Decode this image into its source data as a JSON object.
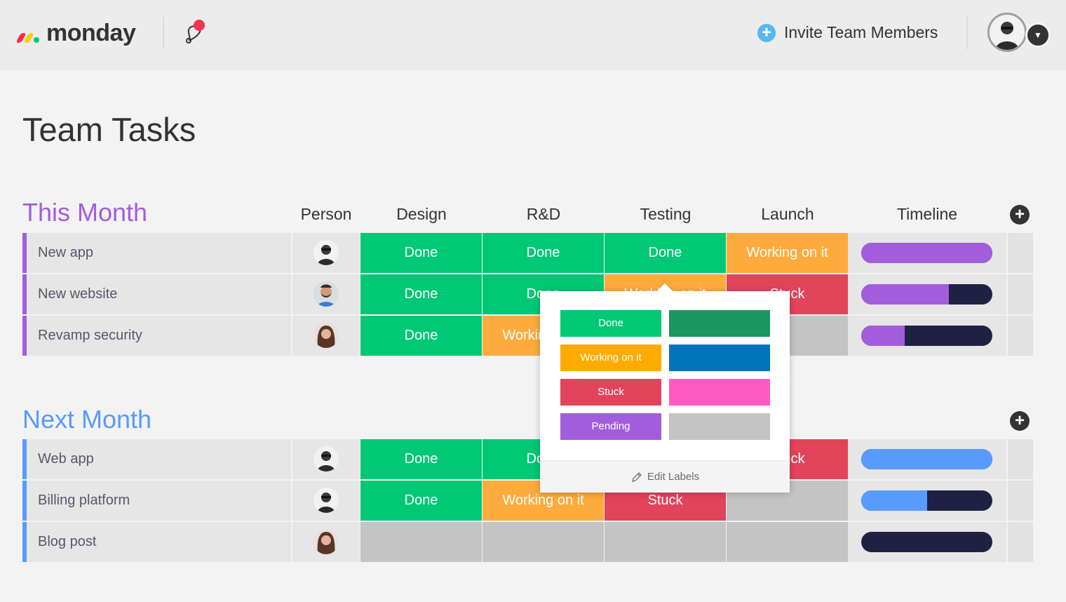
{
  "header": {
    "brand": "monday",
    "invite_label": "Invite Team Members",
    "invite_icon": "plus-icon",
    "notification_badge_color": "#f0354f"
  },
  "board": {
    "title": "Team Tasks",
    "columns": [
      "Person",
      "Design",
      "R&D",
      "Testing",
      "Launch",
      "Timeline"
    ]
  },
  "colors": {
    "done": "#00c875",
    "working": "#fdab3d",
    "stuck": "#e2445c",
    "empty": "#c4c4c4",
    "this_month": "#a25ddc",
    "next_month": "#579bfc",
    "timeline_dark": "#1e2142"
  },
  "groups": [
    {
      "title": "This Month",
      "color": "#a25ddc",
      "rows": [
        {
          "name": "New app",
          "person": "avatar-man-glasses",
          "design": "Done",
          "rnd": "Done",
          "testing": "Done",
          "launch": "Working on it",
          "timeline_progress": 1.0
        },
        {
          "name": "New website",
          "person": "avatar-man-beard",
          "design": "Done",
          "rnd": "Done",
          "testing": "Working on it",
          "launch": "Stuck",
          "timeline_progress": 0.67
        },
        {
          "name": "Revamp security",
          "person": "avatar-woman",
          "design": "Done",
          "rnd": "Working on it",
          "testing": "",
          "launch": "",
          "timeline_progress": 0.33
        }
      ]
    },
    {
      "title": "Next Month",
      "color": "#579bfc",
      "rows": [
        {
          "name": "Web app",
          "person": "avatar-man-glasses",
          "design": "Done",
          "rnd": "Done",
          "testing": "",
          "launch": "Stuck",
          "timeline_progress": 1.0
        },
        {
          "name": "Billing platform",
          "person": "avatar-man-glasses",
          "design": "Done",
          "rnd": "Working on it",
          "testing": "Stuck",
          "launch": "",
          "timeline_progress": 0.5
        },
        {
          "name": "Blog post",
          "person": "avatar-woman",
          "design": "",
          "rnd": "",
          "testing": "",
          "launch": "",
          "timeline_progress": 0.0
        }
      ]
    }
  ],
  "status_popup": {
    "options": [
      {
        "label": "Done",
        "color": "#00c875"
      },
      {
        "label": "",
        "color": "#1a9660"
      },
      {
        "label": "Working on it",
        "color": "#fdab00"
      },
      {
        "label": "",
        "color": "#0073bb"
      },
      {
        "label": "Stuck",
        "color": "#e2445c"
      },
      {
        "label": "",
        "color": "#ff5ac4"
      },
      {
        "label": "Pending",
        "color": "#a25ddc"
      },
      {
        "label": "",
        "color": "#c4c4c4"
      }
    ],
    "edit_labels": "Edit Labels",
    "edit_icon": "pencil-icon"
  }
}
